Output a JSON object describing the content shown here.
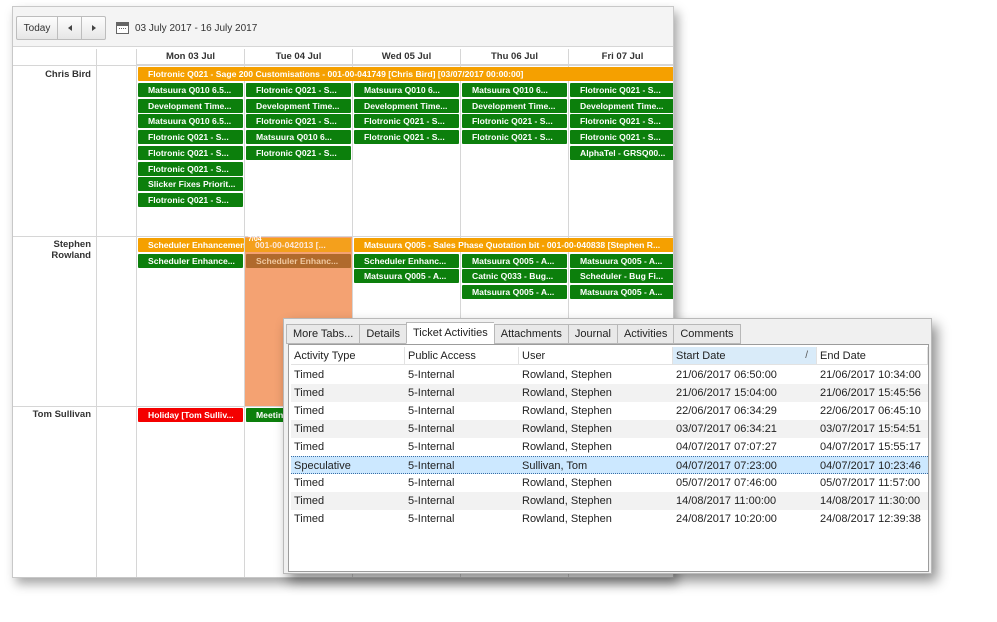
{
  "scheduler": {
    "toolbar": {
      "today_label": "Today",
      "date_range": "03 July 2017 - 16 July 2017"
    },
    "days": [
      "Mon 03 Jul",
      "Tue 04 Jul",
      "Wed 05 Jul",
      "Thu 06 Jul",
      "Fri 07 Jul"
    ],
    "resources": [
      "Chris Bird",
      "Stephen Rowland",
      "Tom Sullivan"
    ],
    "events": {
      "chris_span": "Flotronic Q021 - Sage 200 Customisations - 001-00-041749 [Chris Bird] [03/07/2017 00:00:00]",
      "chris_mon": [
        "Matsuura Q010 6.5...",
        "Development Time...",
        "Matsuura Q010 6.5...",
        "Flotronic Q021 - S...",
        "Flotronic Q021 - S...",
        "Flotronic Q021 - S...",
        "Slicker Fixes Priorit...",
        "Flotronic Q021 - S..."
      ],
      "chris_tue": [
        "Flotronic Q021 - S...",
        "Development Time...",
        "Flotronic Q021 - S...",
        "Matsuura Q010 6...",
        "Flotronic Q021 - S..."
      ],
      "chris_wed": [
        "Matsuura Q010 6...",
        "Development Time...",
        "Flotronic Q021 - S...",
        "Flotronic Q021 - S..."
      ],
      "chris_thu": [
        "Matsuura Q010 6...",
        "Development Time...",
        "Flotronic Q021 - S...",
        "Flotronic Q021 - S..."
      ],
      "chris_fri": [
        "Flotronic Q021 - S...",
        "Development Time...",
        "Flotronic Q021 - S...",
        "Flotronic Q021 - S...",
        "AlphaTel - GRSQ00..."
      ],
      "stephen_span1": "Scheduler Enhancement",
      "stephen_span1_tail": "001-00-042013 [...",
      "stephen_tag": "7/04",
      "stephen_span2": "Matsuura Q005 - Sales Phase Quotation bit - 001-00-040838 [Stephen R...",
      "stephen_mon": "Scheduler Enhance...",
      "stephen_tue": "Scheduler Enhanc...",
      "stephen_wed": [
        "Scheduler Enhanc...",
        "Matsuura Q005 - A..."
      ],
      "stephen_thu": [
        "Matsuura Q005 - A...",
        "Catnic Q033 - Bug...",
        "Matsuura Q005 - A..."
      ],
      "stephen_fri": [
        "Matsuura Q005 - A...",
        "Scheduler - Bug Fi...",
        "Matsuura Q005 - A..."
      ],
      "tom_mon": "Holiday [Tom Sulliv...",
      "tom_tue": "Meetin"
    },
    "colors": {
      "green": "#0c7f0c",
      "orange": "#f5a000",
      "red": "#f40000",
      "selection": "#f4a272"
    }
  },
  "dialog": {
    "tabs": [
      "More Tabs...",
      "Details",
      "Ticket Activities",
      "Attachments",
      "Journal",
      "Activities",
      "Comments"
    ],
    "active_tab": "Ticket Activities",
    "columns": [
      "Activity Type",
      "Public Access",
      "User",
      "Start Date",
      "End Date"
    ],
    "sort_indicator": "/",
    "rows": [
      [
        "Timed",
        "5-Internal",
        "Rowland, Stephen",
        "21/06/2017 06:50:00",
        "21/06/2017 10:34:00"
      ],
      [
        "Timed",
        "5-Internal",
        "Rowland, Stephen",
        "21/06/2017 15:04:00",
        "21/06/2017 15:45:56"
      ],
      [
        "Timed",
        "5-Internal",
        "Rowland, Stephen",
        "22/06/2017 06:34:29",
        "22/06/2017 06:45:10"
      ],
      [
        "Timed",
        "5-Internal",
        "Rowland, Stephen",
        "03/07/2017 06:34:21",
        "03/07/2017 15:54:51"
      ],
      [
        "Timed",
        "5-Internal",
        "Rowland, Stephen",
        "04/07/2017 07:07:27",
        "04/07/2017 15:55:17"
      ],
      [
        "Speculative",
        "5-Internal",
        "Sullivan, Tom",
        "04/07/2017 07:23:00",
        "04/07/2017 10:23:46"
      ],
      [
        "Timed",
        "5-Internal",
        "Rowland, Stephen",
        "05/07/2017 07:46:00",
        "05/07/2017 11:57:00"
      ],
      [
        "Timed",
        "5-Internal",
        "Rowland, Stephen",
        "14/08/2017 11:00:00",
        "14/08/2017 11:30:00"
      ],
      [
        "Timed",
        "5-Internal",
        "Rowland, Stephen",
        "24/08/2017 10:20:00",
        "24/08/2017 12:39:38"
      ]
    ]
  }
}
